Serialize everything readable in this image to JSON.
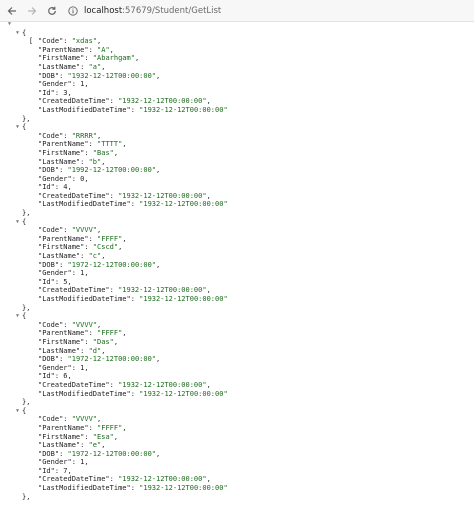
{
  "browser": {
    "back_icon": "arrow-left-icon",
    "forward_icon": "arrow-right-icon",
    "reload_icon": "reload-icon",
    "info_icon": "info-icon",
    "url_host": "localhost",
    "url_rest": ":57679/Student/GetList"
  },
  "json": {
    "open_bracket": "[",
    "records": [
      {
        "Code": "xdas",
        "ParentName": "A",
        "FirstName": "Abarhgam",
        "LastName": "a",
        "DOB": "1932-12-12T00:00:00",
        "Gender": "1",
        "Id": "3",
        "CreatedDateTime": "1932-12-12T00:00:00",
        "LastModifiedDateTime": "1932-12-12T00:00:00"
      },
      {
        "Code": "RRRR",
        "ParentName": "TTTT",
        "FirstName": "Bas",
        "LastName": "b",
        "DOB": "1992-12-12T00:00:00",
        "Gender": "0",
        "Id": "4",
        "CreatedDateTime": "1932-12-12T00:00:00",
        "LastModifiedDateTime": "1932-12-12T00:00:00"
      },
      {
        "Code": "VVVV",
        "ParentName": "FFFF",
        "FirstName": "Cscd",
        "LastName": "c",
        "DOB": "1972-12-12T00:00:00",
        "Gender": "1",
        "Id": "5",
        "CreatedDateTime": "1932-12-12T00:00:00",
        "LastModifiedDateTime": "1932-12-12T00:00:00"
      },
      {
        "Code": "VVVV",
        "ParentName": "FFFF",
        "FirstName": "Das",
        "LastName": "d",
        "DOB": "1972-12-12T00:00:00",
        "Gender": "1",
        "Id": "6",
        "CreatedDateTime": "1932-12-12T00:00:00",
        "LastModifiedDateTime": "1932-12-12T00:00:00"
      },
      {
        "Code": "VVVV",
        "ParentName": "FFFF",
        "FirstName": "Esa",
        "LastName": "e",
        "DOB": "1972-12-12T00:00:00",
        "Gender": "1",
        "Id": "7",
        "CreatedDateTime": "1932-12-12T00:00:00",
        "LastModifiedDateTime": "1932-12-12T00:00:00"
      }
    ],
    "field_order": [
      "Code",
      "ParentName",
      "FirstName",
      "LastName",
      "DOB",
      "Gender",
      "Id",
      "CreatedDateTime",
      "LastModifiedDateTime"
    ],
    "numeric_fields": [
      "Gender",
      "Id"
    ],
    "open_brace": "{",
    "close_brace": "},",
    "last_close_brace": "},"
  }
}
